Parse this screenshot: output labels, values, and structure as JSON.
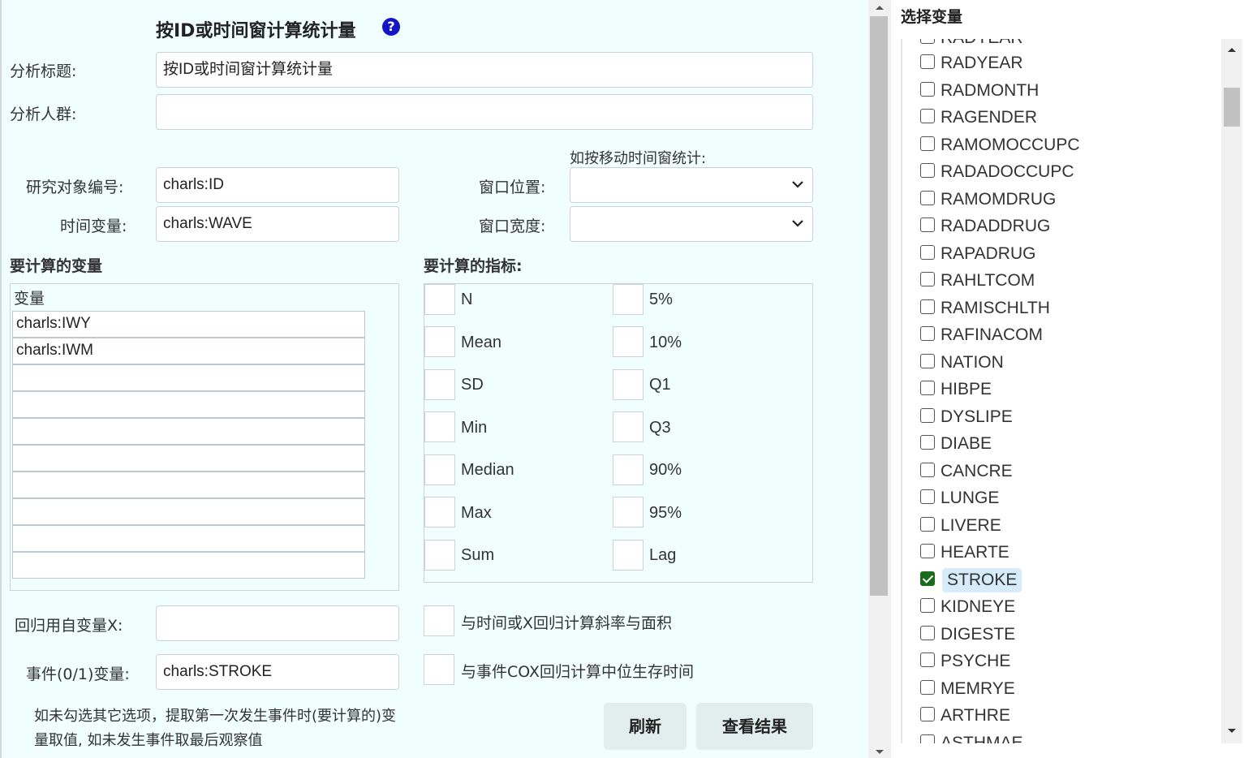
{
  "form": {
    "heading": "按ID或时间窗计算统计量",
    "help_icon": "question-circle-icon",
    "analysis_title_label": "分析标题:",
    "analysis_title_value": "按ID或时间窗计算统计量",
    "population_label": "分析人群:",
    "population_value": "",
    "moving_window_hint": "如按移动时间窗统计:",
    "subject_id_label": "研究对象编号:",
    "subject_id_value": "charls:ID",
    "time_var_label": "时间变量:",
    "time_var_value": "charls:WAVE",
    "window_pos_label": "窗口位置:",
    "window_pos_value": "",
    "window_width_label": "窗口宽度:",
    "window_width_value": "",
    "vars_section_title": "要计算的变量",
    "vars_header": "变量",
    "vars_rows": [
      "charls:IWY",
      "charls:IWM",
      "",
      "",
      "",
      "",
      "",
      "",
      "",
      ""
    ],
    "indicators_section_title": "要计算的指标:",
    "indicators_left": [
      "N",
      "Mean",
      "SD",
      "Min",
      "Median",
      "Max",
      "Sum"
    ],
    "indicators_right": [
      "5%",
      "10%",
      "Q1",
      "Q3",
      "90%",
      "95%",
      "Lag"
    ],
    "regression_x_label": "回归用自变量X:",
    "regression_x_value": "",
    "event_label": "事件(0/1)变量:",
    "event_value": "charls:STROKE",
    "slope_option_label": "与时间或X回归计算斜率与面积",
    "cox_option_label": "与事件COX回归计算中位生存时间",
    "note_text": "如未勾选其它选项，提取第一次发生事件时(要计算的)变量取值, 如未发生事件取最后观察值",
    "refresh_button": "刷新",
    "view_results_button": "查看结果"
  },
  "variable_panel": {
    "title": "选择变量",
    "partial_top": "RADYEAR",
    "items": [
      {
        "name": "RADYEAR",
        "checked": false
      },
      {
        "name": "RADMONTH",
        "checked": false
      },
      {
        "name": "RAGENDER",
        "checked": false
      },
      {
        "name": "RAMOMOCCUPC",
        "checked": false
      },
      {
        "name": "RADADOCCUPC",
        "checked": false
      },
      {
        "name": "RAMOMDRUG",
        "checked": false
      },
      {
        "name": "RADADDRUG",
        "checked": false
      },
      {
        "name": "RAPADRUG",
        "checked": false
      },
      {
        "name": "RAHLTCOM",
        "checked": false
      },
      {
        "name": "RAMISCHLTH",
        "checked": false
      },
      {
        "name": "RAFINACOM",
        "checked": false
      },
      {
        "name": "NATION",
        "checked": false
      },
      {
        "name": "HIBPE",
        "checked": false
      },
      {
        "name": "DYSLIPE",
        "checked": false
      },
      {
        "name": "DIABE",
        "checked": false
      },
      {
        "name": "CANCRE",
        "checked": false
      },
      {
        "name": "LUNGE",
        "checked": false
      },
      {
        "name": "LIVERE",
        "checked": false
      },
      {
        "name": "HEARTE",
        "checked": false
      },
      {
        "name": "STROKE",
        "checked": true
      },
      {
        "name": "KIDNEYE",
        "checked": false
      },
      {
        "name": "DIGESTE",
        "checked": false
      },
      {
        "name": "PSYCHE",
        "checked": false
      },
      {
        "name": "MEMRYE",
        "checked": false
      },
      {
        "name": "ARTHRE",
        "checked": false
      }
    ],
    "partial_bottom": "ASTHMAE"
  },
  "colors": {
    "panel_bg": "#f0fefe",
    "help_icon": "#1515c8",
    "checked": "#1a6b1a",
    "selected_bg": "#d6ecfa",
    "button_bg": "#e2eeee"
  }
}
